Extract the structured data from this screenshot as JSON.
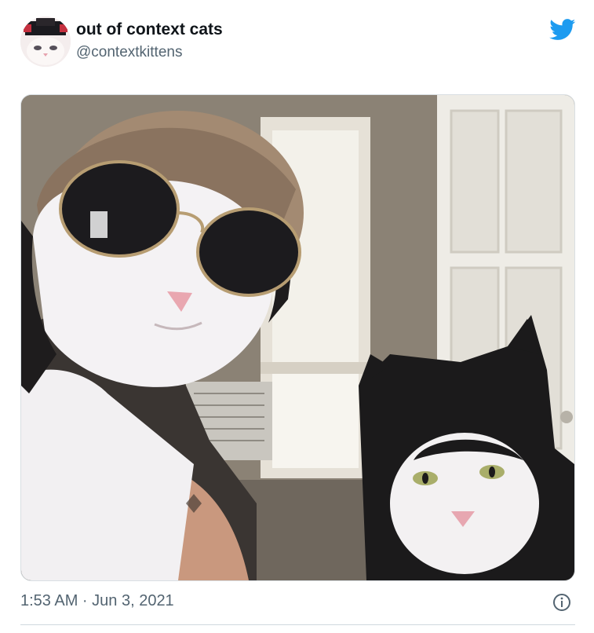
{
  "tweet": {
    "display_name": "out of context cats",
    "handle": "@contextkittens",
    "timestamp": "1:53 AM · Jun 3, 2021"
  },
  "icons": {
    "brand": "twitter-bird-icon",
    "info": "info-icon"
  },
  "colors": {
    "twitter_blue": "#1d9bf0",
    "name_text": "#0f1419",
    "secondary_text": "#536471",
    "divider": "#cfd9de"
  }
}
